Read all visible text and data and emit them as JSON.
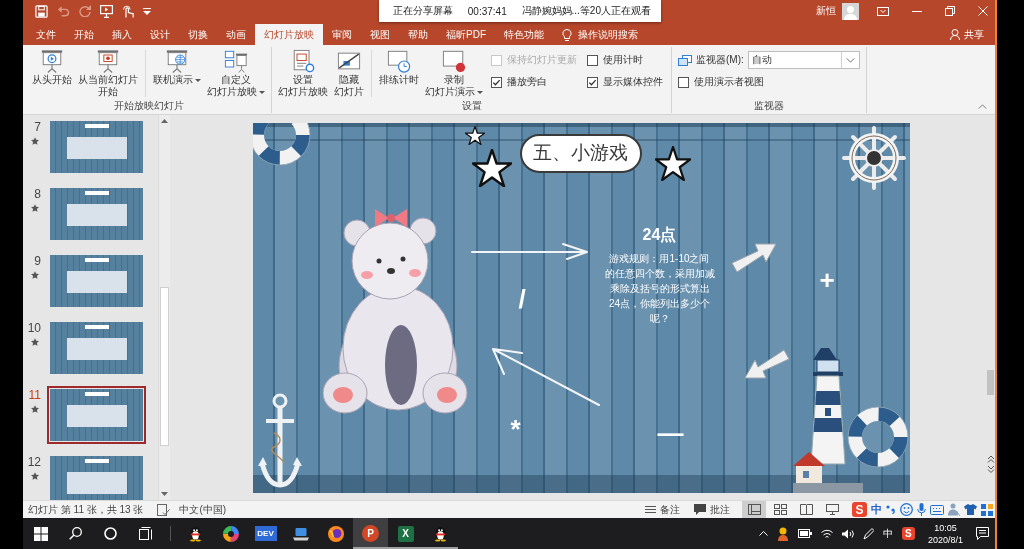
{
  "title_bar": {
    "quick_access": [
      {
        "kind": "save",
        "disabled": false
      },
      {
        "kind": "undo",
        "disabled": true
      },
      {
        "kind": "redo",
        "disabled": true
      },
      {
        "kind": "slideshow",
        "disabled": false
      },
      {
        "kind": "touch",
        "disabled": false
      },
      {
        "kind": "customize",
        "disabled": false
      }
    ],
    "user_name": "新恒"
  },
  "share_banner": {
    "status": "正在分享屏幕",
    "timer": "00:37:41",
    "viewers": "冯静婉妈妈...等20人正在观看"
  },
  "tabs": [
    {
      "label": "文件",
      "selected": false
    },
    {
      "label": "开始",
      "selected": false
    },
    {
      "label": "插入",
      "selected": false
    },
    {
      "label": "设计",
      "selected": false
    },
    {
      "label": "切换",
      "selected": false
    },
    {
      "label": "动画",
      "selected": false
    },
    {
      "label": "幻灯片放映",
      "selected": true
    },
    {
      "label": "审阅",
      "selected": false
    },
    {
      "label": "视图",
      "selected": false
    },
    {
      "label": "帮助",
      "selected": false
    },
    {
      "label": "福昕PDF",
      "selected": false
    },
    {
      "label": "特色功能",
      "selected": false
    }
  ],
  "tell_me": {
    "placeholder": "操作说明搜索"
  },
  "share_button": {
    "label": "共享"
  },
  "ribbon": {
    "groups": [
      {
        "label": "开始放映幻灯片",
        "items": [
          {
            "kind": "large",
            "label": "从头开始",
            "dropdown": false
          },
          {
            "kind": "large",
            "label": "从当前幻灯片开始",
            "dropdown": false
          },
          {
            "kind": "separator"
          },
          {
            "kind": "large",
            "label": "联机演示",
            "dropdown": true
          },
          {
            "kind": "large",
            "label": "自定义幻灯片放映",
            "dropdown": true
          }
        ]
      },
      {
        "label": "设置",
        "items": [
          {
            "kind": "large",
            "label": "设置幻灯片放映",
            "dropdown": false
          },
          {
            "kind": "large",
            "label": "隐藏幻灯片",
            "dropdown": false
          },
          {
            "kind": "separator"
          },
          {
            "kind": "large",
            "label": "排练计时",
            "dropdown": false
          },
          {
            "kind": "large",
            "label": "录制幻灯片演示",
            "dropdown": true
          },
          {
            "kind": "checks",
            "options": [
              {
                "label": "保持幻灯片更新",
                "checked": false,
                "disabled": true
              },
              {
                "label": "播放旁白",
                "checked": true,
                "disabled": false
              }
            ]
          },
          {
            "kind": "checks",
            "options": [
              {
                "label": "使用计时",
                "checked": false,
                "disabled": false
              },
              {
                "label": "显示媒体控件",
                "checked": true,
                "disabled": false
              }
            ]
          }
        ]
      },
      {
        "label": "监视器",
        "items": [
          {
            "kind": "monitor",
            "label": "监视器(M):",
            "value": "自动",
            "option": {
              "label": "使用演示者视图",
              "checked": false,
              "disabled": false
            }
          }
        ]
      }
    ]
  },
  "slides": [
    {
      "number": "7",
      "selected": false
    },
    {
      "number": "8",
      "selected": false
    },
    {
      "number": "9",
      "selected": false
    },
    {
      "number": "10",
      "selected": false
    },
    {
      "number": "11",
      "selected": true
    },
    {
      "number": "12",
      "selected": false
    }
  ],
  "slide": {
    "title": "五、小游戏",
    "heading": "24点",
    "body": "游戏规则：用1-10之间的任意四个数，采用加减乘除及括号的形式算出24点，你能列出多少个呢？",
    "symbols": [
      "/",
      "+",
      "*",
      "—"
    ]
  },
  "status_bar": {
    "slide_info": "幻灯片 第 11 张，共 13 张",
    "language": "中文(中国)",
    "notes": "备注",
    "comments": "批注",
    "views": [
      {
        "kind": "normal",
        "selected": true
      },
      {
        "kind": "sorter",
        "selected": false
      },
      {
        "kind": "reading",
        "selected": false
      },
      {
        "kind": "slideshow",
        "selected": false
      }
    ],
    "ime": {
      "logo": "S",
      "mode": "中"
    }
  },
  "taskbar": {
    "apps": [
      {
        "kind": "penguin",
        "running": false,
        "active": false
      },
      {
        "kind": "ring",
        "running": false,
        "active": false
      },
      {
        "kind": "tile",
        "logo": "DEV",
        "running": false,
        "active": false
      },
      {
        "kind": "laptop",
        "running": false,
        "active": false
      },
      {
        "kind": "flame",
        "running": false,
        "active": false
      },
      {
        "kind": "slides",
        "logo": "P",
        "running": true,
        "active": true
      },
      {
        "kind": "sheet",
        "logo": "X",
        "running": true,
        "active": false
      },
      {
        "kind": "penguin",
        "running": true,
        "active": false
      }
    ],
    "tray": {
      "ime_mode": "中",
      "ime_logo": "S",
      "time": "10:05",
      "date": "2020/8/1"
    }
  }
}
